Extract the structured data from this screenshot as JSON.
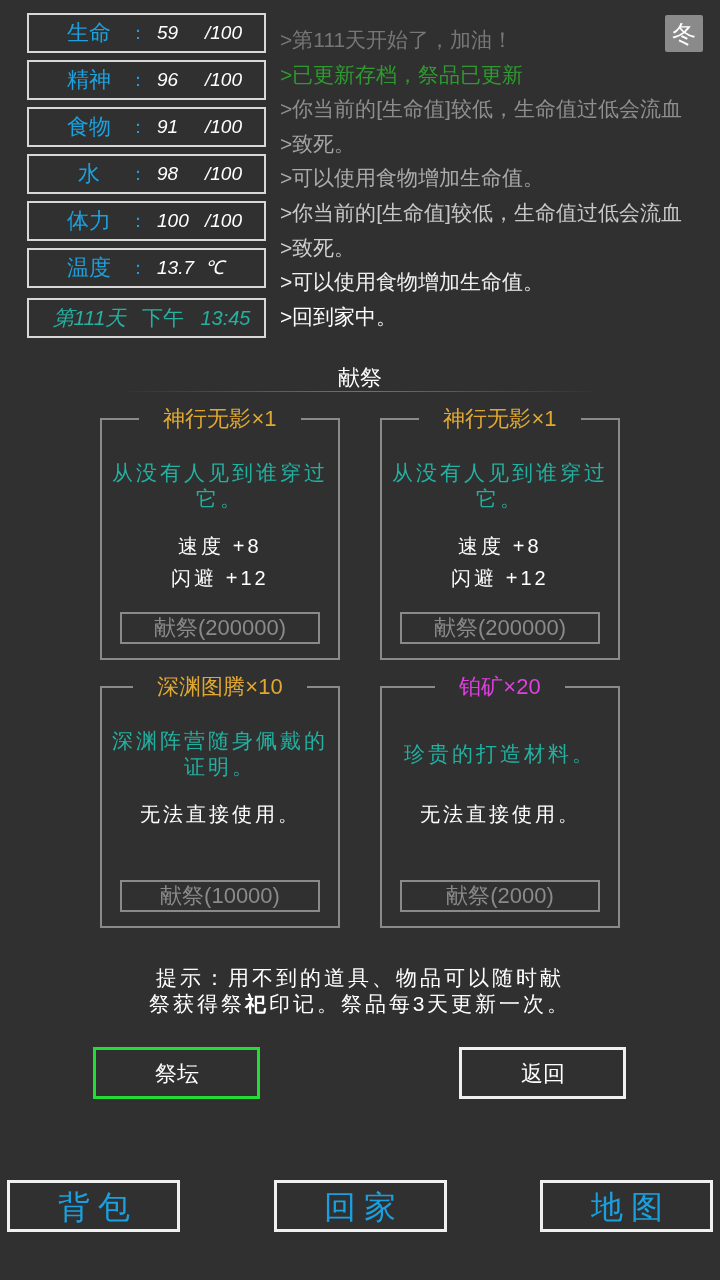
{
  "stats": [
    {
      "label": "生命",
      "colon": "：",
      "value": "59",
      "max": "/100"
    },
    {
      "label": "精神",
      "colon": "：",
      "value": "96",
      "max": "/100"
    },
    {
      "label": "食物",
      "colon": "：",
      "value": "91",
      "max": "/100"
    },
    {
      "label": "水",
      "colon": "：",
      "value": "98",
      "max": "/100"
    },
    {
      "label": "体力",
      "colon": "：",
      "value": "100",
      "max": "/100"
    },
    {
      "label": "温度",
      "colon": "：",
      "value": "13.7",
      "max": "℃"
    }
  ],
  "clock": {
    "day": "第111天",
    "period": "下午",
    "time": "13:45"
  },
  "season": "冬",
  "log": [
    {
      "text": ">第111天开始了，加油！",
      "color": "#777777"
    },
    {
      "text": ">已更新存档，祭品已更新",
      "color": "#2f9a2f"
    },
    {
      "text": ">你当前的[生命值]较低，生命值过低会流血",
      "color": "#8e8e8e"
    },
    {
      "text": ">致死。",
      "color": "#a4a4a4"
    },
    {
      "text": ">可以使用食物增加生命值。",
      "color": "#ababab"
    },
    {
      "text": ">你当前的[生命值]较低，生命值过低会流血",
      "color": "#c8c8c8"
    },
    {
      "text": ">致死。",
      "color": "#cfcfcf"
    },
    {
      "text": ">可以使用食物增加生命值。",
      "color": "#f0f0f0"
    },
    {
      "text": ">回到家中。",
      "color": "#ffffff"
    }
  ],
  "section_title": "献祭",
  "offerings": [
    {
      "name": "神行无影×1",
      "color": "#e0a830",
      "description": "从没有人见到谁穿过它。",
      "effects": [
        "速度 +8",
        "闪避 +12"
      ],
      "button": "献祭(200000)",
      "disabled": true
    },
    {
      "name": "神行无影×1",
      "color": "#e0a830",
      "description": "从没有人见到谁穿过它。",
      "effects": [
        "速度 +8",
        "闪避 +12"
      ],
      "button": "献祭(200000)",
      "disabled": true
    },
    {
      "name": "深渊图腾×10",
      "color": "#e0a830",
      "description": "深渊阵营随身佩戴的证明。",
      "effects": [
        "无法直接使用。"
      ],
      "button": "献祭(10000)",
      "disabled": true
    },
    {
      "name": "铂矿×20",
      "color": "#e040e0",
      "description": "珍贵的打造材料。",
      "effects": [
        "无法直接使用。"
      ],
      "button": "献祭(2000)",
      "disabled": true
    }
  ],
  "hint": "提示：用不到的道具、物品可以随时献祭获得祭**祀**印记。祭品每3天更新一次。",
  "actions": [
    {
      "label": "祭坛",
      "selected": true
    },
    {
      "label": "返回",
      "selected": false
    }
  ],
  "nav": [
    {
      "label": "背包"
    },
    {
      "label": "回家"
    },
    {
      "label": "地图"
    }
  ]
}
